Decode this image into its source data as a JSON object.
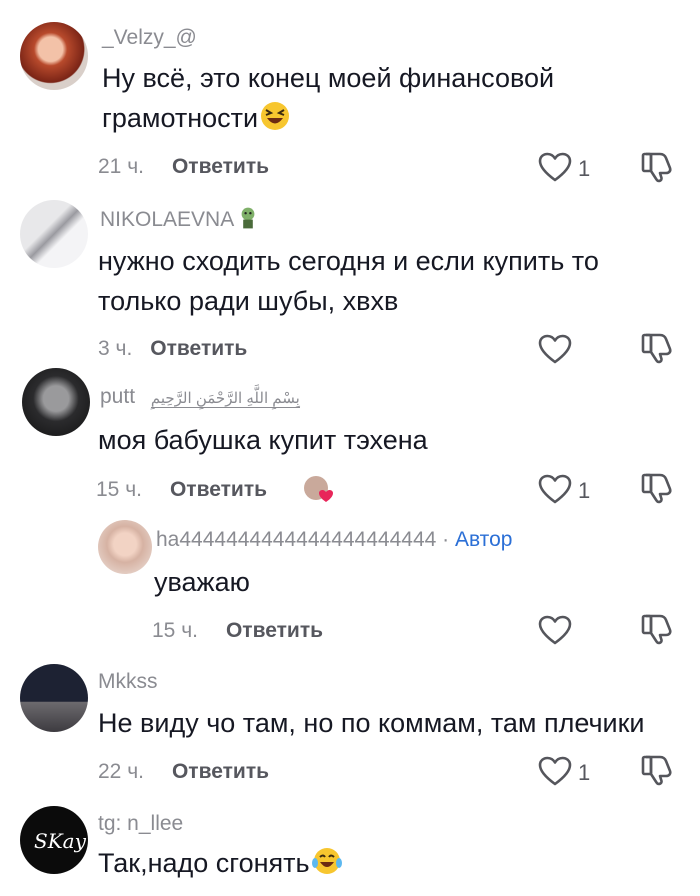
{
  "comments": [
    {
      "username": "_Velzy_@",
      "text_line1": "Ну всё, это конец моей финансовой",
      "text_line2": "грамотности",
      "emoji": "laughing-squint-emoji",
      "time": "21 ч.",
      "reply_label": "Ответить",
      "likes": "1"
    },
    {
      "username": "NIKOLAEVNA",
      "name_emoji": "zombie-emoji",
      "text_line1": "нужно сходить сегодня и если купить то",
      "text_line2": "только ради шубы, хвхв",
      "time": "3 ч.",
      "reply_label": "Ответить"
    },
    {
      "username": "putt",
      "name_decoration": "بِسْمِ اللَّهِ الرَّحْمَنِ الرَّحِيمِ",
      "text_line1": "моя бабушка купит тэхена",
      "time": "15 ч.",
      "reply_label": "Ответить",
      "likes": "1"
    },
    {
      "username": "ha4444444444444444444444",
      "separator": " · ",
      "badge": "Автор",
      "text_line1": "уважаю",
      "time": "15 ч.",
      "reply_label": "Ответить"
    },
    {
      "username": "Mkkss",
      "text_line1": "Не виду чо там, но по коммам, там плечики",
      "time": "22 ч.",
      "reply_label": "Ответить",
      "likes": "1"
    },
    {
      "username": "tg: n_llee",
      "text_line1": "Так,надо сгонять",
      "emoji": "tears-of-joy-emoji"
    }
  ]
}
